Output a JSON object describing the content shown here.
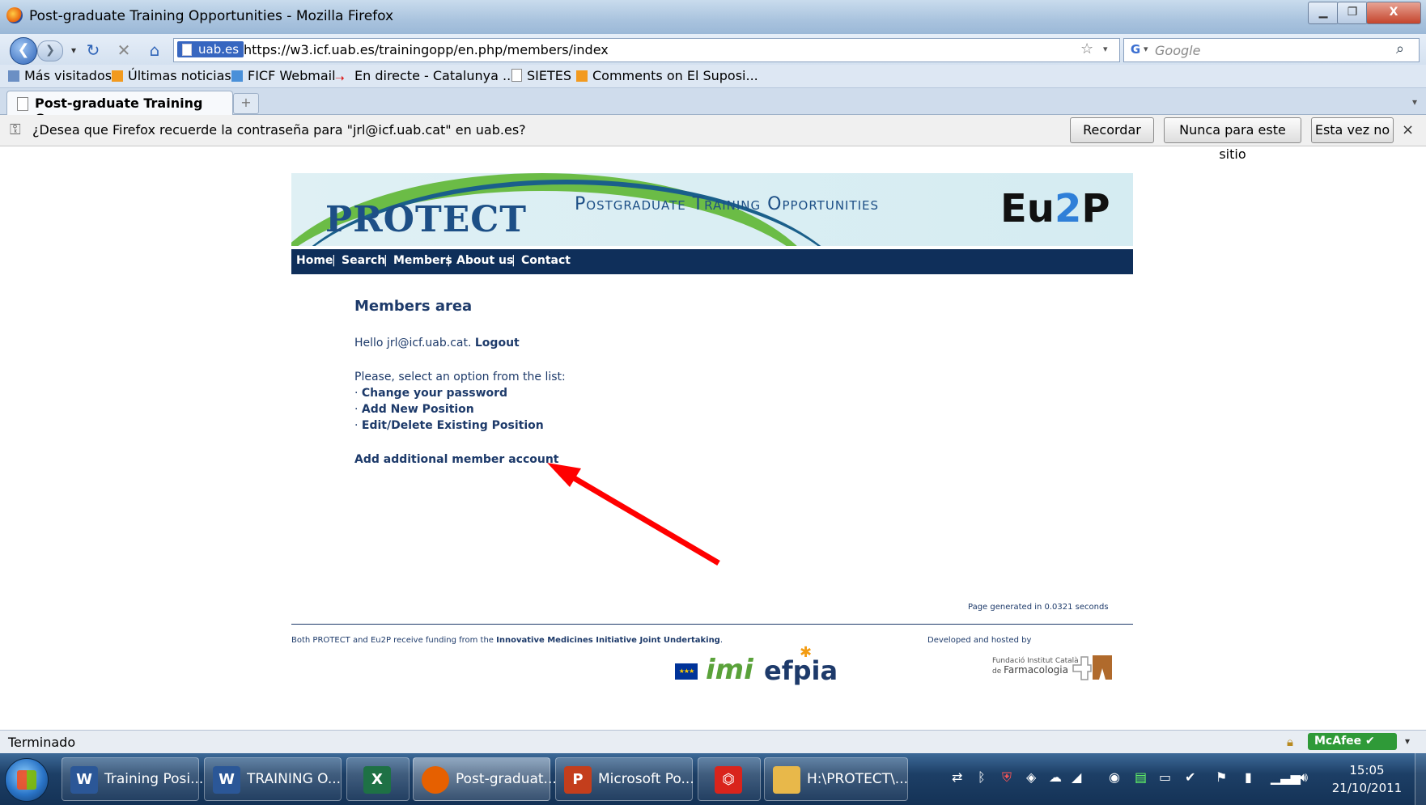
{
  "window": {
    "title": "Post-graduate Training Opportunities - Mozilla Firefox",
    "min_icon": "minimize-icon",
    "max_icon": "maximize-icon",
    "close_label": "X"
  },
  "navbar": {
    "back_icon": "back-arrow-icon",
    "forward_icon": "forward-arrow-icon",
    "reload_icon": "reload-icon",
    "stop_icon": "stop-icon",
    "home_icon": "home-icon",
    "site_badge": "uab.es",
    "url": "https://w3.icf.uab.es/trainingopp/en.php/members/index",
    "search_placeholder": "Google"
  },
  "bookmarks": [
    {
      "label": "Más visitados",
      "icon": "bookmark-icon"
    },
    {
      "label": "Últimas noticias",
      "icon": "rss-icon"
    },
    {
      "label": "FICF Webmail",
      "icon": "mail-icon"
    },
    {
      "label": "En directe - Catalunya ...",
      "icon": "arrow-icon"
    },
    {
      "label": "SIETES",
      "icon": "page-icon"
    },
    {
      "label": "Comments on El Suposi...",
      "icon": "rss-icon"
    }
  ],
  "tabs": [
    {
      "label": "Post-graduate Training Oppo..."
    }
  ],
  "notification": {
    "message": "¿Desea que Firefox recuerde la contraseña para \"jrl@icf.uab.cat\" en uab.es?",
    "buttons": [
      "Recordar",
      "Nunca para este sitio",
      "Esta vez no"
    ],
    "close_label": "×"
  },
  "site": {
    "logo": "PROTECT",
    "banner_title": "Postgraduate Training Opportunities",
    "logo_right_a": "Eu",
    "logo_right_b": "2",
    "logo_right_c": "P",
    "menu": [
      "Home",
      "Search",
      "Members",
      "About us",
      "Contact"
    ],
    "menu_sep": "|",
    "members_title": "Members area",
    "hello_prefix": "Hello jrl@icf.uab.cat.",
    "logout": "Logout",
    "select_prompt": "Please, select an option from the list:",
    "options": [
      "Change your password",
      "Add New Position",
      "Edit/Delete Existing Position"
    ],
    "option_bullet": "·",
    "add_account": "Add additional member account",
    "page_generated": "Page generated in 0.0321 seconds",
    "funding_prefix": "Both PROTECT and Eu2P receive funding from the",
    "funding_link": "Innovative Medicines Initiative Joint Undertaking",
    "funding_suffix": ".",
    "developed_by": "Developed and hosted by",
    "imi_logo": "imi",
    "efpia_logo": "efpia",
    "ficf_line1": "Fundació Institut Català",
    "ficf_line2": "de",
    "ficf_line3": "Farmacologia"
  },
  "annotation": {
    "arrow_color": "#ff0000"
  },
  "status": {
    "text": "Terminado",
    "mcafee": "McAfee"
  },
  "taskbar": {
    "items": [
      {
        "label": "Training Posi...",
        "icon": "word-icon",
        "color": "#2b5797"
      },
      {
        "label": "TRAINING O...",
        "icon": "word-icon",
        "color": "#2b5797"
      },
      {
        "label": "",
        "icon": "excel-icon",
        "color": "#1e7145"
      },
      {
        "label": "Post-graduat...",
        "icon": "firefox-icon",
        "color": "#e66000"
      },
      {
        "label": "Microsoft Po...",
        "icon": "powerpoint-icon",
        "color": "#c43e1c"
      },
      {
        "label": "",
        "icon": "pdf-icon",
        "color": "#d9241c"
      },
      {
        "label": "H:\\PROTECT\\...",
        "icon": "folder-icon",
        "color": "#e8b84a"
      }
    ],
    "time": "15:05",
    "date": "21/10/2011"
  }
}
